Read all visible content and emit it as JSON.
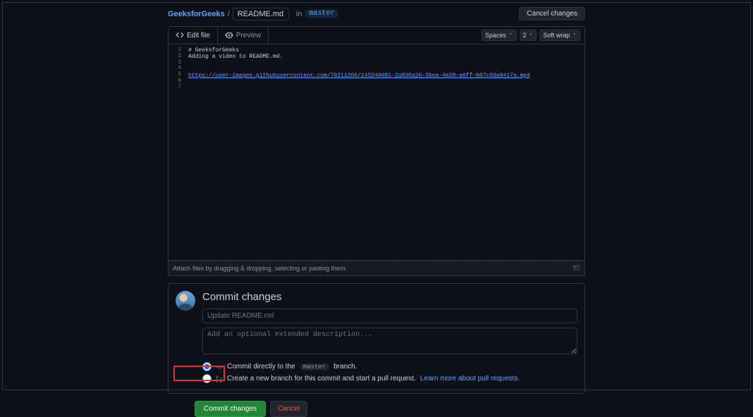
{
  "header": {
    "repo": "GeeksforGeeks",
    "filename": "README.md",
    "in_label": "in",
    "branch": "master",
    "cancel_changes": "Cancel changes"
  },
  "tabs": {
    "edit": "Edit file",
    "preview": "Preview",
    "spaces": "Spaces",
    "indent": "2",
    "wrap": "Soft wrap"
  },
  "editor": {
    "lines": [
      "1",
      "2",
      "3",
      "4",
      "5",
      "6",
      "7"
    ],
    "line1": "# GeeksforGeeks",
    "line2": "Adding a video to README.md.",
    "line5": "https://user-images.githubusercontent.com/70211300/145240091-2a830a26-3bea-4e28-a6ff-b07c00a9417a.mp4"
  },
  "attach_hint": "Attach files by dragging & dropping, selecting or pasting them.",
  "commit": {
    "heading": "Commit changes",
    "summary_placeholder": "Update README.md",
    "desc_placeholder": "Add an optional extended description...",
    "direct_prefix": "Commit directly to the",
    "direct_branch": "master",
    "direct_suffix": "branch.",
    "newbranch_text": "Create a new branch for this commit and start a pull request.",
    "learn_more": "Learn more about pull requests.",
    "commit_btn": "Commit changes",
    "cancel_btn": "Cancel"
  }
}
